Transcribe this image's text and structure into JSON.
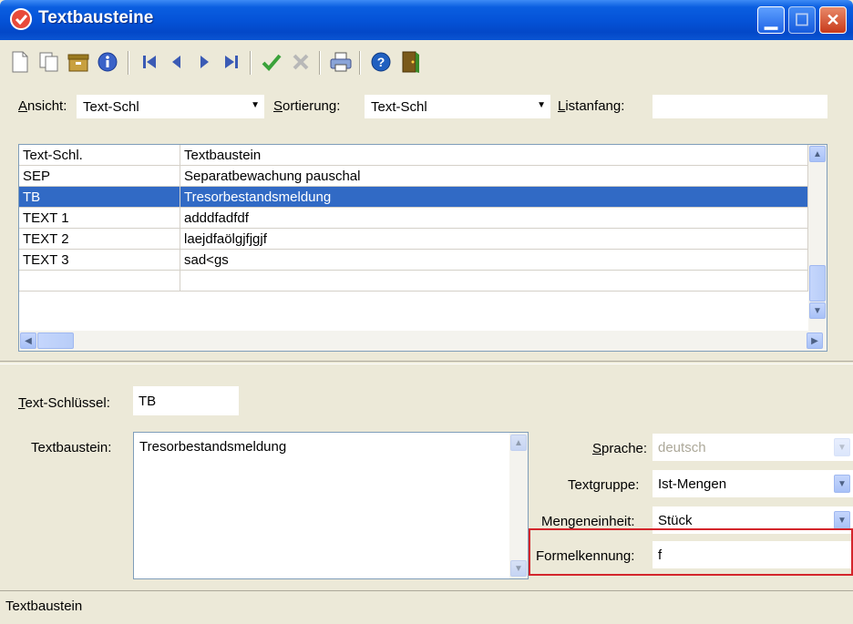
{
  "window": {
    "title": "Textbausteine",
    "minimize_label": "_",
    "maximize_label": "□",
    "close_label": "X"
  },
  "toolbar": {
    "buttons": [
      {
        "name": "new-icon",
        "glyph": "🗋"
      },
      {
        "name": "copy-icon",
        "glyph": "⧉"
      },
      {
        "name": "archive-icon",
        "glyph": "▤"
      },
      {
        "name": "info-icon",
        "glyph": "ⓘ"
      },
      {
        "name": "first-record-icon",
        "glyph": "⏮"
      },
      {
        "name": "previous-record-icon",
        "glyph": "◀"
      },
      {
        "name": "next-record-icon",
        "glyph": "▶"
      },
      {
        "name": "last-record-icon",
        "glyph": "⏭"
      },
      {
        "name": "save-check-icon",
        "glyph": "✔"
      },
      {
        "name": "cancel-x-icon",
        "glyph": "✖"
      },
      {
        "name": "print-icon",
        "glyph": "🖶"
      },
      {
        "name": "help-icon",
        "glyph": "?"
      },
      {
        "name": "exit-door-icon",
        "glyph": "⇥"
      }
    ],
    "colors": {
      "nav": "#3b5bb5",
      "check": "#3aa23a",
      "cancel": "#b0b0b0",
      "help": "#2060c0"
    }
  },
  "filter": {
    "ansicht_label_u": "A",
    "ansicht_label_rest": "nsicht:",
    "ansicht_value": "Text-Schl",
    "sortierung_label_u": "S",
    "sortierung_label_rest": "ortierung:",
    "sortierung_value": "Text-Schl",
    "listanfang_label_u": "L",
    "listanfang_label_rest": "istanfang:",
    "listanfang_value": ""
  },
  "grid": {
    "columns": [
      "Text-Schl.",
      "Textbaustein"
    ],
    "rows": [
      {
        "key": "SEP",
        "text": "Separatbewachung pauschal",
        "selected": false
      },
      {
        "key": "TB",
        "text": "Tresorbestandsmeldung",
        "selected": true
      },
      {
        "key": "TEXT 1",
        "text": "adddfadfdf",
        "selected": false
      },
      {
        "key": "TEXT 2",
        "text": "laejdfaölgjfjgjf",
        "selected": false
      },
      {
        "key": "TEXT 3",
        "text": "sad<gs",
        "selected": false
      },
      {
        "key": "",
        "text": "",
        "selected": false
      }
    ],
    "selection_color": "#316ac5"
  },
  "form": {
    "text_schluessel_label_u": "T",
    "text_schluessel_label_rest": "ext-Schlüssel:",
    "text_schluessel_value": "TB",
    "textbaustein_label": "Textbaustein:",
    "textbaustein_value": "Tresorbestandsmeldung",
    "sprache_label_u": "S",
    "sprache_label_rest": "prache:",
    "sprache_value": "deutsch",
    "textgruppe_label": "Textgruppe:",
    "textgruppe_value": "Ist-Mengen",
    "mengeneinheit_label": "Mengeneinheit:",
    "mengeneinheit_value": "Stück",
    "formelkennung_label": "Formelkennung:",
    "formelkennung_value": "f",
    "highlight_color": "#d4262c"
  },
  "statusbar": {
    "text": "Textbaustein"
  }
}
